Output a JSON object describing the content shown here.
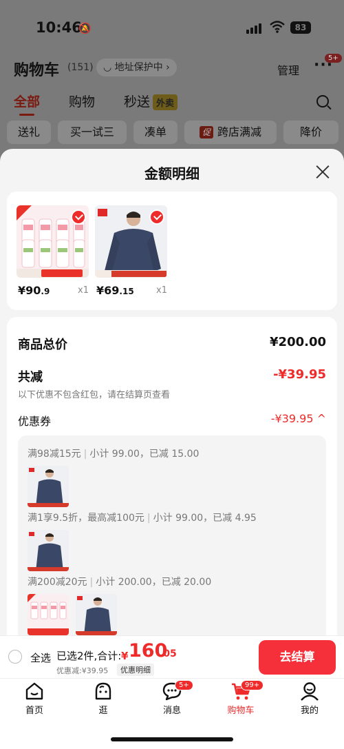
{
  "status_bar": {
    "time": "10:46",
    "battery": "83"
  },
  "cart_header": {
    "title": "购物车",
    "count": "(151)",
    "address_chip": "地址保护中",
    "manage": "管理",
    "more_badge": "5+"
  },
  "tabs": [
    {
      "label": "全部"
    },
    {
      "label": "购物"
    },
    {
      "label": "秒送"
    }
  ],
  "takeout_badge": "外卖",
  "filters": [
    "送礼",
    "买一试三",
    "凑单",
    "跨店满减",
    "降价"
  ],
  "promo_tag": "促",
  "sheet": {
    "title": "金额明细",
    "products": [
      {
        "price_main": "¥90",
        "price_decimal": ".9",
        "qty": "x1"
      },
      {
        "price_main": "¥69",
        "price_decimal": ".15",
        "qty": "x1"
      }
    ],
    "total_label": "商品总价",
    "total_value": "¥200.00",
    "reduce_label": "共减",
    "reduce_value": "-¥39.95",
    "note": "以下优惠不包含红包，请在结算页查看",
    "coupon_label": "优惠券",
    "coupon_value": "-¥39.95",
    "coupons": [
      {
        "rule": "满98减15元",
        "detail": "小计 99.00，已减 15.00"
      },
      {
        "rule": "满1享9.5折，最高减100元",
        "detail": "小计 99.00，已减 4.95"
      },
      {
        "rule": "满200减20元",
        "detail": "小计 200.00，已减 20.00"
      }
    ]
  },
  "bottom_bar": {
    "select_all": "全选",
    "selected_text": "已选2件,合计:",
    "currency": "¥",
    "total_int": "160",
    "total_dec": ".05",
    "discount_text": "优惠减:¥39.95",
    "detail_chip": "优惠明细",
    "checkout": "去结算"
  },
  "tabbar": [
    {
      "label": "首页",
      "icon": "home-icon"
    },
    {
      "label": "逛",
      "icon": "discover-icon"
    },
    {
      "label": "消息",
      "icon": "message-icon",
      "badge": "5+"
    },
    {
      "label": "购物车",
      "icon": "cart-icon",
      "badge": "99+"
    },
    {
      "label": "我的",
      "icon": "profile-icon"
    }
  ],
  "colors": {
    "accent": "#ee2a2a",
    "checkout_button": "#f5303a"
  }
}
